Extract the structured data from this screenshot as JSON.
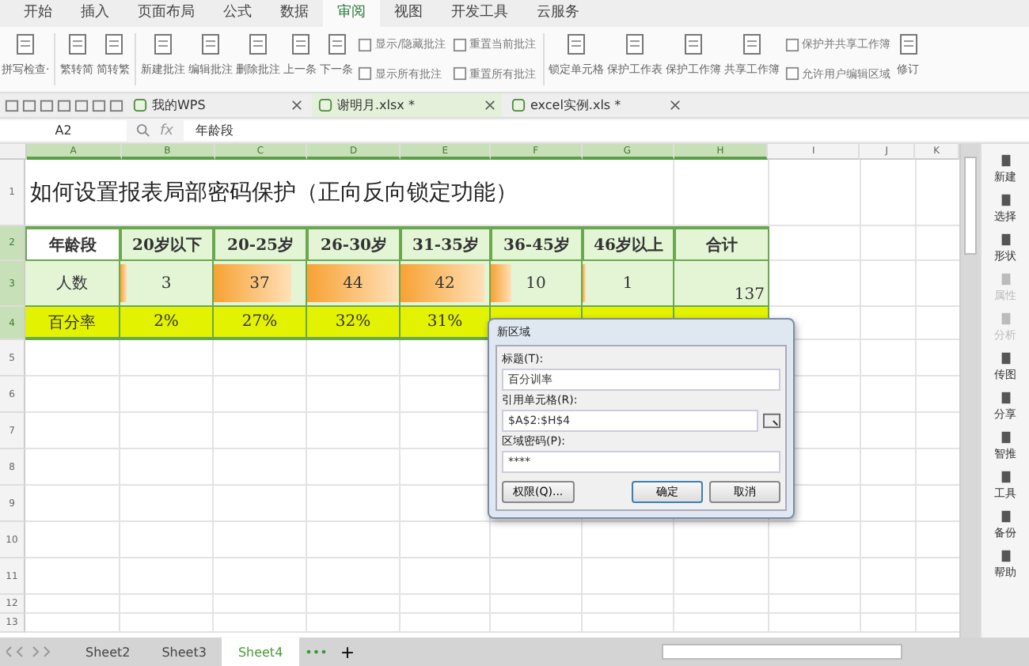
{
  "menu_tabs": [
    {
      "label": "开始",
      "selected": false
    },
    {
      "label": "插入",
      "selected": false
    },
    {
      "label": "页面布局",
      "selected": false
    },
    {
      "label": "公式",
      "selected": false
    },
    {
      "label": "数据",
      "selected": false
    },
    {
      "label": "审阅",
      "selected": true
    },
    {
      "label": "视图",
      "selected": false
    },
    {
      "label": "开发工具",
      "selected": false
    },
    {
      "label": "云服务",
      "selected": false
    }
  ],
  "ribbon": [
    {
      "kind": "big",
      "label": "拼写检查·"
    },
    {
      "kind": "sep"
    },
    {
      "kind": "big",
      "label": "繁转简"
    },
    {
      "kind": "big",
      "label": "简转繁"
    },
    {
      "kind": "sep"
    },
    {
      "kind": "big",
      "label": "新建批注"
    },
    {
      "kind": "big",
      "label": "编辑批注"
    },
    {
      "kind": "big",
      "label": "删除批注"
    },
    {
      "kind": "big",
      "label": "上一条"
    },
    {
      "kind": "big",
      "label": "下一条"
    },
    {
      "kind": "small",
      "items": [
        "显示/隐藏批注",
        "显示所有批注"
      ]
    },
    {
      "kind": "small",
      "items": [
        "重置当前批注",
        "重置所有批注"
      ]
    },
    {
      "kind": "sep"
    },
    {
      "kind": "big",
      "label": "锁定单元格"
    },
    {
      "kind": "big",
      "label": "保护工作表"
    },
    {
      "kind": "big",
      "label": "保护工作簿"
    },
    {
      "kind": "big",
      "label": "共享工作簿"
    },
    {
      "kind": "small",
      "items": [
        "保护并共享工作簿",
        "允许用户编辑区域"
      ]
    },
    {
      "kind": "big",
      "label": "修订"
    }
  ],
  "doc_tabs": [
    {
      "label": "我的WPS",
      "selected": false
    },
    {
      "label": "谢明月.xlsx *",
      "selected": true
    },
    {
      "label": "excel实例.xls *",
      "selected": false
    }
  ],
  "formula_bar": {
    "cell": "A2",
    "fx": "fx",
    "value": "年龄段"
  },
  "columns": [
    {
      "label": "A",
      "selected": true
    },
    {
      "label": "B",
      "selected": true
    },
    {
      "label": "C",
      "selected": true
    },
    {
      "label": "D",
      "selected": true
    },
    {
      "label": "E",
      "selected": true
    },
    {
      "label": "F",
      "selected": true
    },
    {
      "label": "G",
      "selected": true
    },
    {
      "label": "H",
      "selected": true
    },
    {
      "label": "I",
      "selected": false
    },
    {
      "label": "J",
      "selected": false
    },
    {
      "label": "K",
      "selected": false
    }
  ],
  "rows": [
    {
      "number": "1",
      "kind": "title",
      "selected": false,
      "title": "如何设置报表局部密码保护（正向反向锁定功能）"
    },
    {
      "number": "2",
      "kind": "header",
      "selected": true,
      "cells": [
        {
          "text": "年龄段"
        },
        {
          "text": "20岁以下"
        },
        {
          "text": "20-25岁"
        },
        {
          "text": "26-30岁"
        },
        {
          "text": "31-35岁"
        },
        {
          "text": "36-45岁"
        },
        {
          "text": "46岁以上"
        },
        {
          "text": "合计"
        }
      ]
    },
    {
      "number": "3",
      "kind": "count",
      "selected": true,
      "cells": [
        {
          "text": "人数"
        },
        {
          "text": "3",
          "level": 0.07
        },
        {
          "text": "37",
          "level": 0.84
        },
        {
          "text": "44",
          "level": 1
        },
        {
          "text": "42",
          "level": 0.95
        },
        {
          "text": "10",
          "level": 0.23
        },
        {
          "text": "1",
          "level": 0.03
        },
        {
          "text": "137"
        }
      ]
    },
    {
      "number": "4",
      "kind": "percent",
      "selected": true,
      "cells": [
        {
          "text": "百分率"
        },
        {
          "text": "2%"
        },
        {
          "text": "27%"
        },
        {
          "text": "32%"
        },
        {
          "text": "31%"
        },
        {},
        {},
        {}
      ]
    },
    {
      "number": "5",
      "kind": "blank",
      "selected": false
    },
    {
      "number": "6",
      "kind": "blank",
      "selected": false
    },
    {
      "number": "7",
      "kind": "blank",
      "selected": false
    },
    {
      "number": "8",
      "kind": "blank",
      "selected": false
    },
    {
      "number": "9",
      "kind": "blank",
      "selected": false
    },
    {
      "number": "10",
      "kind": "blank",
      "selected": false
    },
    {
      "number": "11",
      "kind": "blank",
      "selected": false
    },
    {
      "number": "12",
      "kind": "short",
      "selected": false
    },
    {
      "number": "13",
      "kind": "short",
      "selected": false
    }
  ],
  "dialog": {
    "title": "新区域",
    "fields": [
      {
        "label": "标题(T):",
        "value": "百分训率",
        "picker": false
      },
      {
        "label": "引用单元格(R):",
        "value": "$A$2:$H$4",
        "picker": true
      },
      {
        "label": "区域密码(P):",
        "value": "****",
        "picker": false
      }
    ],
    "buttons": [
      {
        "label": "权限(Q)...",
        "kind": "left"
      },
      {
        "label": "确定",
        "kind": "default"
      },
      {
        "label": "取消",
        "kind": "normal"
      }
    ]
  },
  "sidebar": [
    {
      "label": "新建",
      "disabled": false
    },
    {
      "label": "选择",
      "disabled": false
    },
    {
      "label": "形状",
      "disabled": false
    },
    {
      "label": "属性",
      "disabled": true
    },
    {
      "label": "分析",
      "disabled": true
    },
    {
      "label": "传图",
      "disabled": false
    },
    {
      "label": "分享",
      "disabled": false
    },
    {
      "label": "智推",
      "disabled": false
    },
    {
      "label": "工具",
      "disabled": false
    },
    {
      "label": "备份",
      "disabled": false
    },
    {
      "label": "帮助",
      "disabled": false
    }
  ],
  "sheet_tabs": [
    {
      "label": "Sheet2",
      "selected": false
    },
    {
      "label": "Sheet3",
      "selected": false
    },
    {
      "label": "Sheet4",
      "selected": true
    }
  ],
  "sheet_more": "•••",
  "sheet_add": "+"
}
